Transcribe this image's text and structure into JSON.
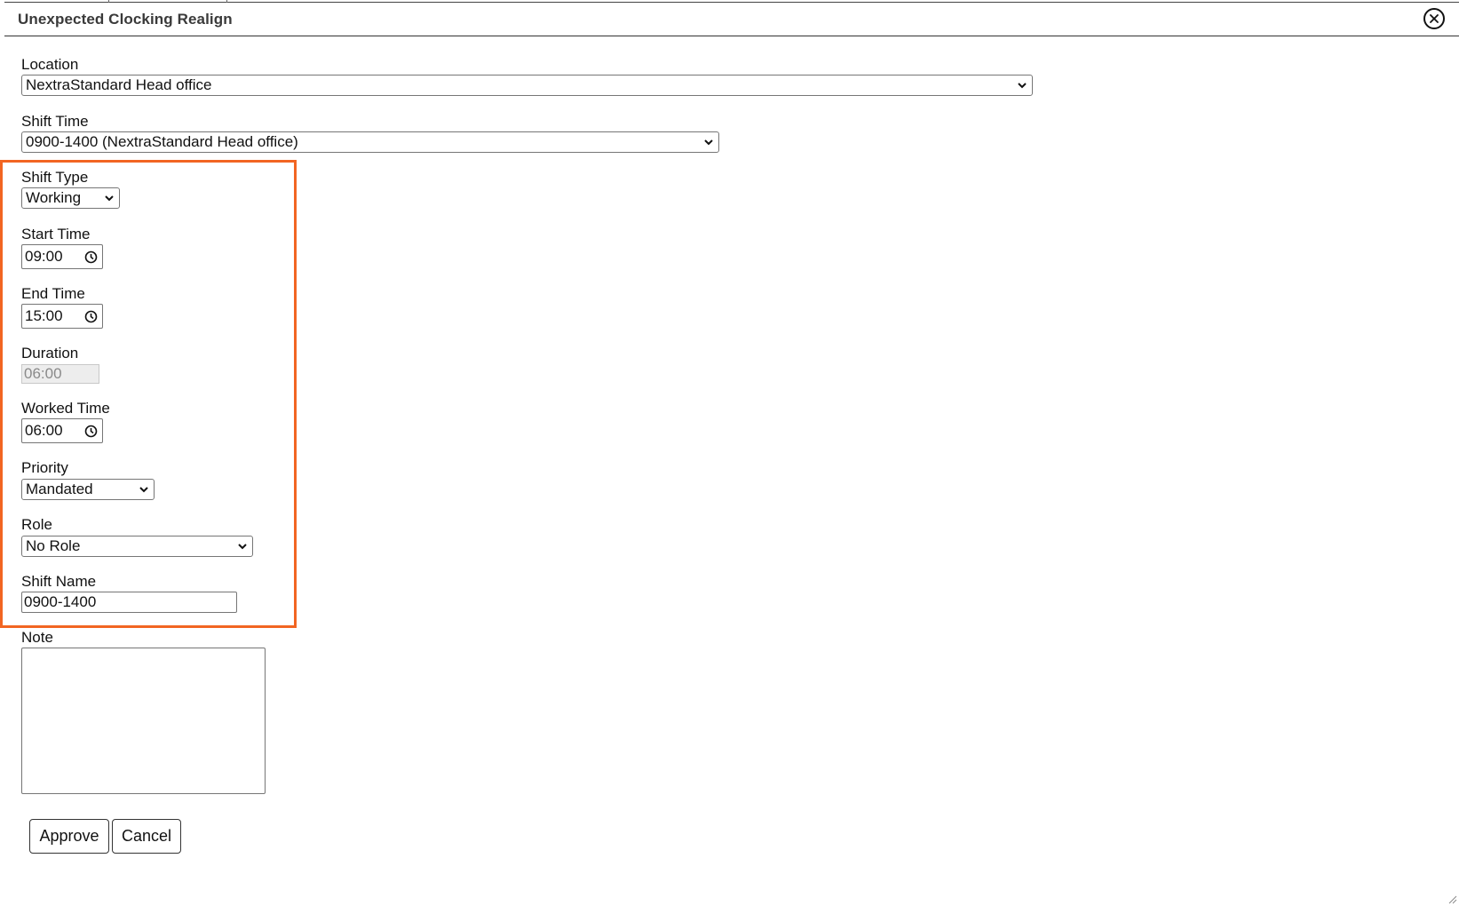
{
  "dialog": {
    "title": "Unexpected Clocking Realign",
    "close_icon": "close-circle-icon"
  },
  "form": {
    "location": {
      "label": "Location",
      "value": "NextraStandard Head office"
    },
    "shift_time": {
      "label": "Shift Time",
      "value": "0900-1400 (NextraStandard Head office)"
    },
    "shift_type": {
      "label": "Shift Type",
      "value": "Working"
    },
    "start_time": {
      "label": "Start Time",
      "value": "09:00"
    },
    "end_time": {
      "label": "End Time",
      "value": "15:00"
    },
    "duration": {
      "label": "Duration",
      "value": "06:00"
    },
    "worked_time": {
      "label": "Worked Time",
      "value": "06:00"
    },
    "priority": {
      "label": "Priority",
      "value": "Mandated"
    },
    "role": {
      "label": "Role",
      "value": "No Role"
    },
    "shift_name": {
      "label": "Shift Name",
      "value": "0900-1400"
    },
    "note": {
      "label": "Note",
      "value": ""
    }
  },
  "actions": {
    "approve_label": "Approve",
    "cancel_label": "Cancel"
  },
  "colors": {
    "highlight": "#f26522",
    "title_text": "#3a3a3a"
  }
}
